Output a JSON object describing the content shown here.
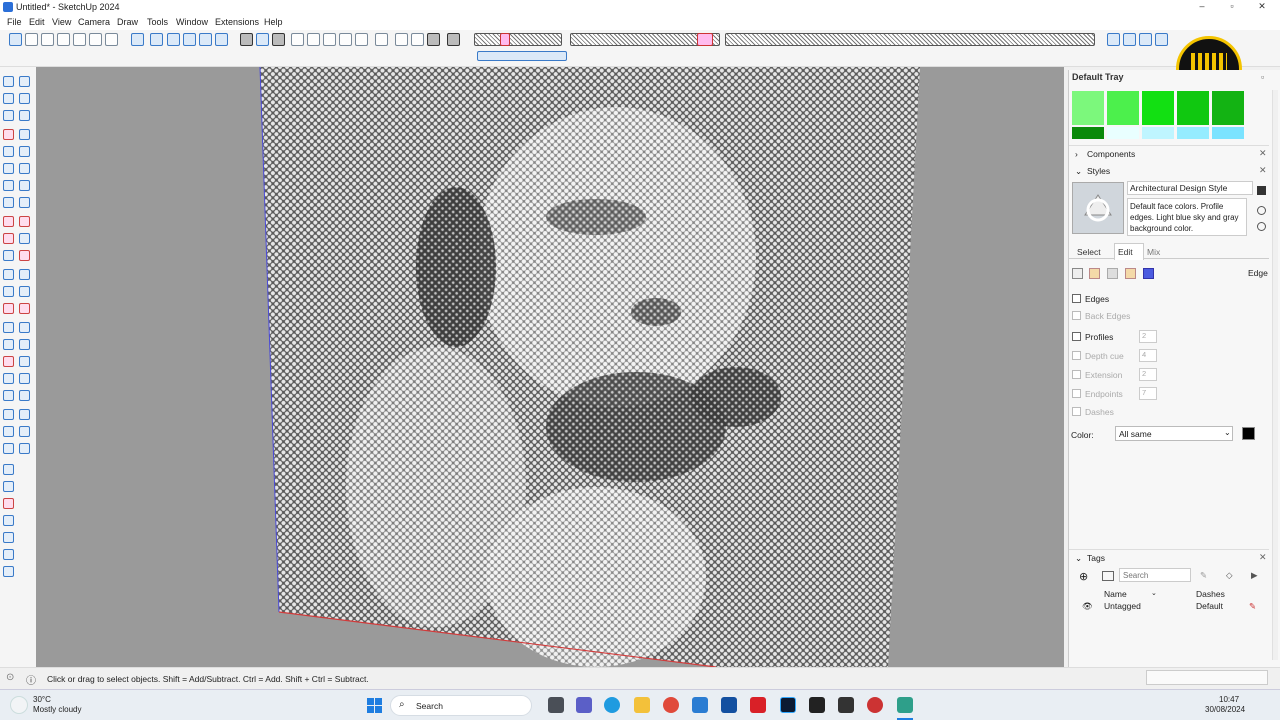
{
  "window": {
    "title": "Untitled* - SketchUp 2024",
    "minimize": "–",
    "maximize": "▫",
    "close": "✕"
  },
  "menu": [
    "File",
    "Edit",
    "View",
    "Camera",
    "Draw",
    "Tools",
    "Window",
    "Extensions",
    "Help"
  ],
  "tray": {
    "title": "Default Tray",
    "swatch_colors": [
      "#7cf87c",
      "#4cf04c",
      "#12e012",
      "#10c810",
      "#13b313",
      "#0a8a0a",
      "#e9ffff",
      "#bff5ff",
      "#95ecff",
      "#7be3ff"
    ],
    "components": {
      "label": "Components",
      "arrow": "›"
    },
    "styles": {
      "label": "Styles",
      "arrow": "⌄",
      "style_name": "Architectural Design Style",
      "style_description": "Default face colors. Profile edges. Light blue sky and gray background color.",
      "tabs": [
        "Select",
        "Edit",
        "Mix"
      ],
      "active_tab": "Edit",
      "edge_label": "Edge",
      "settings": [
        {
          "label": "Edges",
          "enabled": true,
          "checked": false,
          "value": ""
        },
        {
          "label": "Back Edges",
          "enabled": false,
          "checked": false,
          "value": ""
        },
        {
          "label": "Profiles",
          "enabled": true,
          "checked": false,
          "value": "2"
        },
        {
          "label": "Depth cue",
          "enabled": false,
          "checked": false,
          "value": "4"
        },
        {
          "label": "Extension",
          "enabled": false,
          "checked": false,
          "value": "2"
        },
        {
          "label": "Endpoints",
          "enabled": false,
          "checked": false,
          "value": "7"
        },
        {
          "label": "Dashes",
          "enabled": false,
          "checked": false,
          "value": ""
        }
      ],
      "color_label": "Color:",
      "color_value": "All same",
      "color_swatch": "#000000"
    },
    "tags": {
      "label": "Tags",
      "arrow": "⌄",
      "search_placeholder": "Search",
      "col_name": "Name",
      "col_dashes": "Dashes",
      "rows": [
        {
          "name": "Untagged",
          "dashes": "Default"
        }
      ]
    }
  },
  "status": {
    "hint": "Click or drag to select objects. Shift = Add/Subtract. Ctrl = Add. Shift + Ctrl = Subtract."
  },
  "taskbar": {
    "weather_temp": "30°C",
    "weather_desc": "Mostly cloudy",
    "search_label": "Search",
    "time": "10:47",
    "date": "30/08/2024"
  },
  "colors": {
    "accent": "#2b6fd8",
    "viewport_bg": "#9a9a9a",
    "photo_bg": "#cfcfcf",
    "edge_red": "#d23a3a"
  }
}
